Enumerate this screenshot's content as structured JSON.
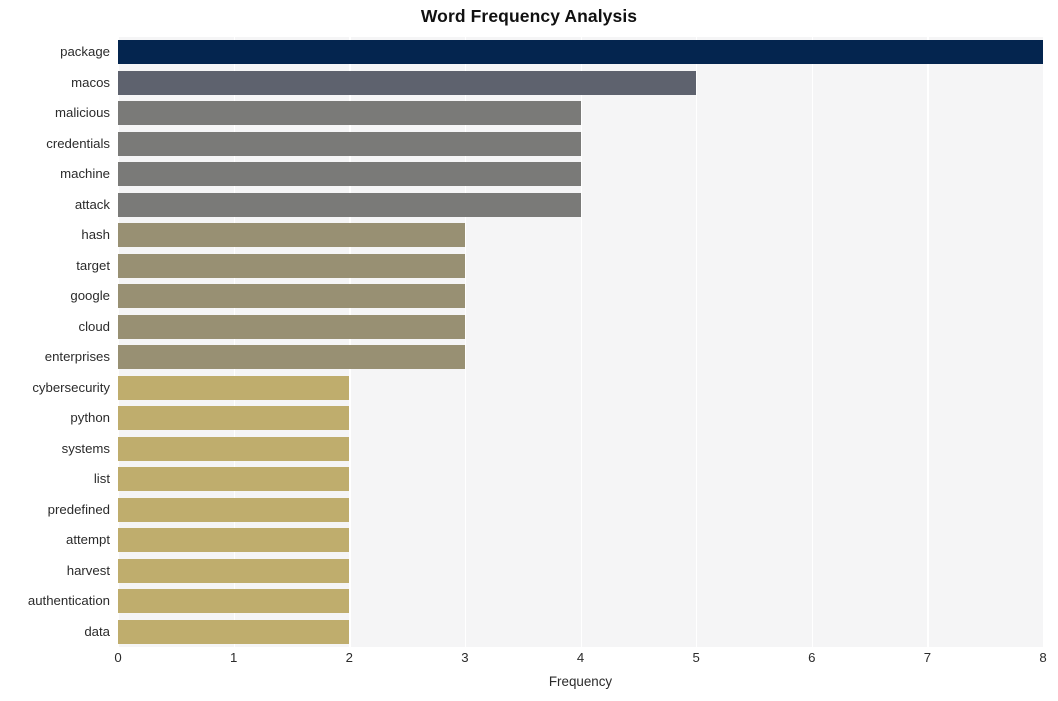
{
  "chart_data": {
    "type": "bar",
    "orientation": "horizontal",
    "title": "Word Frequency Analysis",
    "xlabel": "Frequency",
    "ylabel": "",
    "xlim": [
      0,
      8
    ],
    "xticks": [
      "0",
      "1",
      "2",
      "3",
      "4",
      "5",
      "6",
      "7",
      "8"
    ],
    "grid": true,
    "legend": false,
    "categories": [
      "package",
      "macos",
      "malicious",
      "credentials",
      "machine",
      "attack",
      "hash",
      "target",
      "google",
      "cloud",
      "enterprises",
      "cybersecurity",
      "python",
      "systems",
      "list",
      "predefined",
      "attempt",
      "harvest",
      "authentication",
      "data"
    ],
    "values": [
      8,
      5,
      4,
      4,
      4,
      4,
      3,
      3,
      3,
      3,
      3,
      2,
      2,
      2,
      2,
      2,
      2,
      2,
      2,
      2
    ],
    "bar_colors": [
      "#04254f",
      "#5e626e",
      "#7a7a78",
      "#7a7a78",
      "#7a7a78",
      "#7a7a78",
      "#989073",
      "#989073",
      "#989073",
      "#989073",
      "#989073",
      "#bfad6d",
      "#bfad6d",
      "#bfad6d",
      "#bfad6d",
      "#bfad6d",
      "#bfad6d",
      "#bfad6d",
      "#bfad6d",
      "#bfad6d"
    ]
  },
  "style": {
    "plot_background": "#f5f5f6",
    "figure_background": "#ffffff",
    "gridline_color": "#ffffff",
    "text_color": "#2b2b2b",
    "title_color": "#111111"
  }
}
